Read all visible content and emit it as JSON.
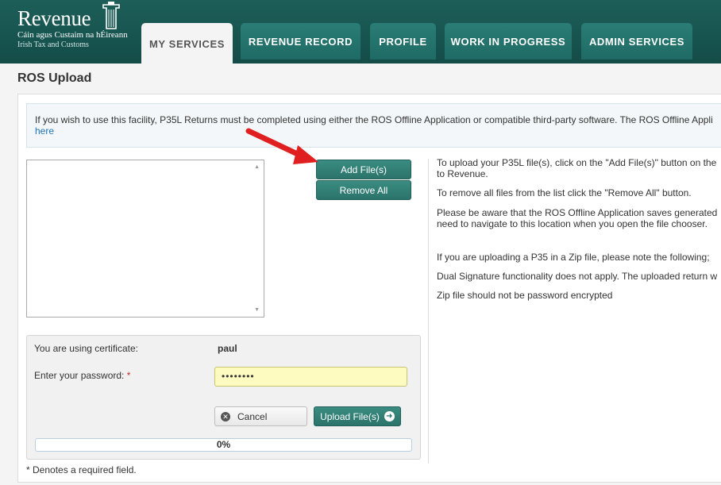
{
  "brand": {
    "name": "Revenue",
    "irish": "Cáin agus Custaim na hÉireann",
    "english": "Irish Tax and Customs"
  },
  "tabs": [
    {
      "label": "MY SERVICES",
      "active": true
    },
    {
      "label": "REVENUE RECORD",
      "active": false
    },
    {
      "label": "PROFILE",
      "active": false
    },
    {
      "label": "WORK IN PROGRESS",
      "active": false
    },
    {
      "label": "ADMIN SERVICES",
      "active": false
    }
  ],
  "page": {
    "title": "ROS Upload"
  },
  "info": {
    "text": "If you wish to use this facility, P35L Returns must be completed using either the ROS Offline Application or compatible third-party software. The ROS Offline Appli",
    "link": "here"
  },
  "buttons": {
    "add_files": "Add File(s)",
    "remove_all": "Remove All",
    "cancel": "Cancel",
    "upload": "Upload File(s)"
  },
  "help": {
    "line1": "To upload your P35L file(s), click on the \"Add File(s)\" button on the",
    "line1b": "to Revenue.",
    "line2": "To remove all files from the list click the \"Remove All\" button.",
    "line3": "Please be aware that the ROS Offline Application saves generated",
    "line3b": "need to navigate to this location when you open the file chooser.",
    "line4": "If you are uploading a P35 in a Zip file, please note the following;",
    "line5": "Dual Signature functionality does not apply. The uploaded return w",
    "line6": "Zip file should not be password encrypted"
  },
  "certificate": {
    "label": "You are using certificate:",
    "value": "paul",
    "password_label": "Enter your password:",
    "required_mark": "*",
    "password_masked": "••••••••"
  },
  "progress": {
    "value": 0,
    "label": "0%"
  },
  "footnote": "* Denotes a required field.",
  "colors": {
    "header": "#1d5e58",
    "button": "#2b736b",
    "arrow": "#e02020",
    "link": "#1e73b9"
  }
}
